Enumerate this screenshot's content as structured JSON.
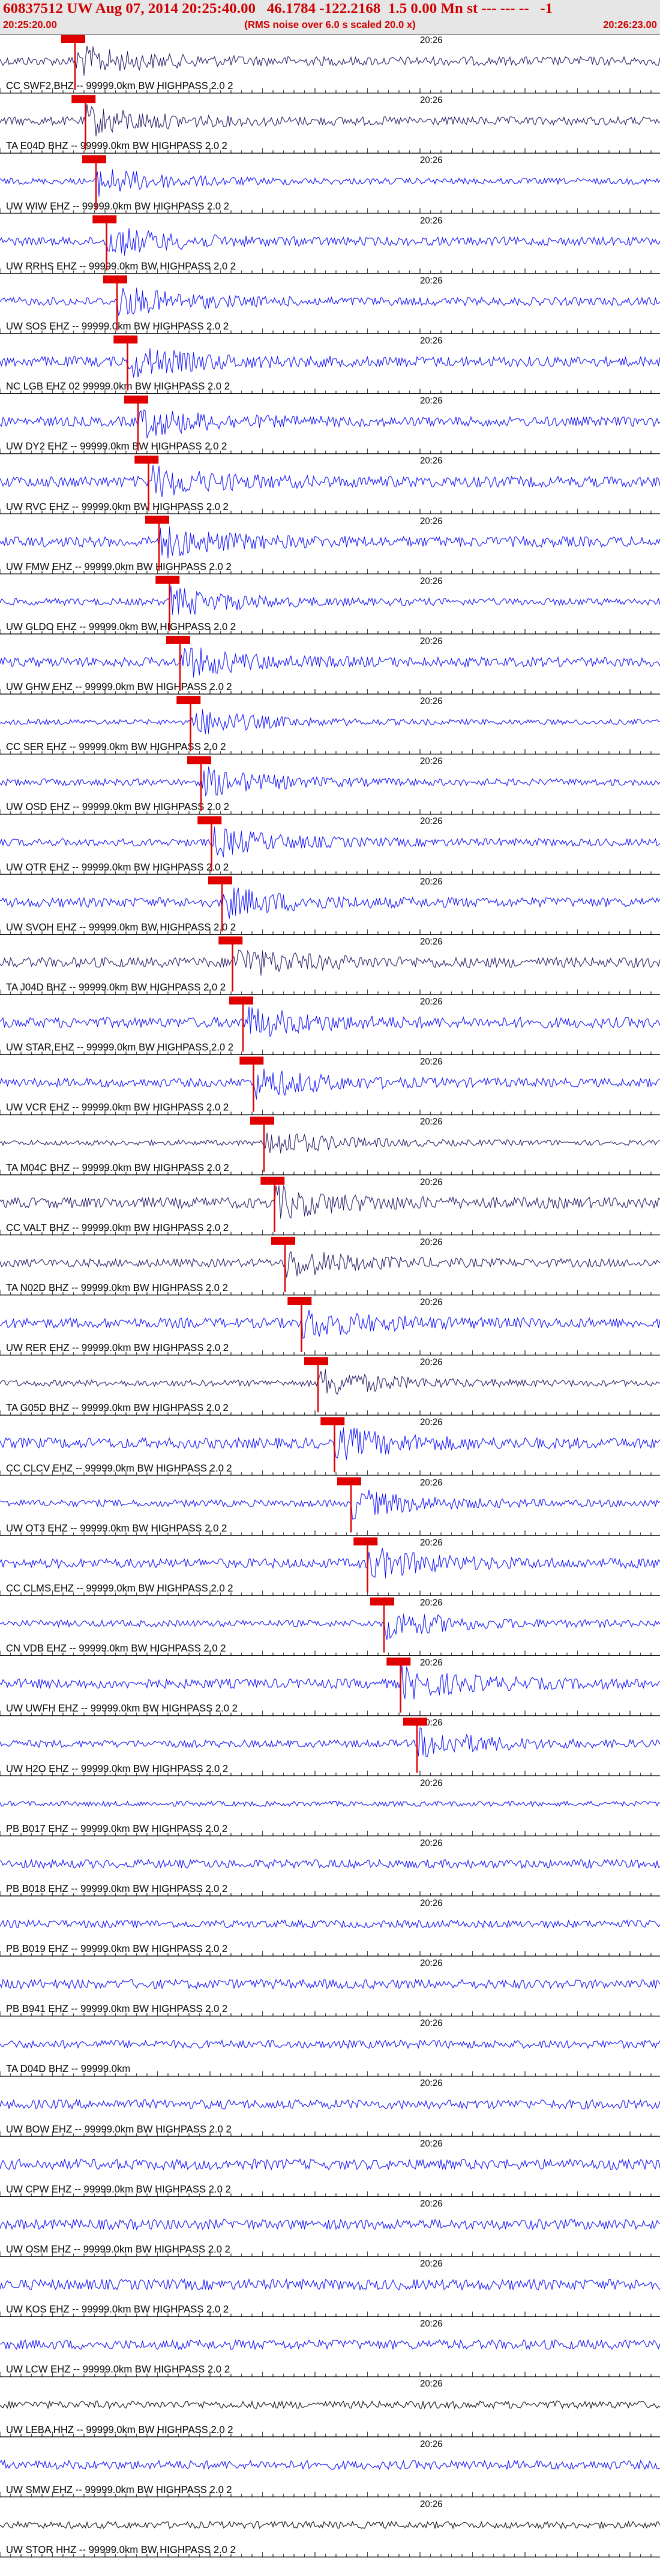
{
  "header": {
    "title": "60837512 UW Aug 07, 2014 20:25:40.00   46.1784 -122.2168  1.5 0.00 Mn st --- --- --   -1",
    "rms_note": "(RMS noise over 6.0 s scaled 20.0 x)",
    "start_time": "20:25:20.00",
    "end_time": "20:26:23.00"
  },
  "colors": {
    "trace_blue": "#0000ff",
    "trace_navy": "#1a0a5e",
    "trace_black": "#000000",
    "pick_red": "#e00000",
    "header_red": "#d00000"
  },
  "chart_data": {
    "type": "seismogram",
    "time_range": [
      "20:25:20.00",
      "20:26:23.00"
    ],
    "minute_mark_label": "20:26",
    "channels": [
      {
        "label": "CC SWF2 BHZ -- 99999.0km BW  HIGHPASS  2.0  2",
        "pick": true,
        "color": "navy"
      },
      {
        "label": "TA E04D BHZ -- 99999.0km BW  HIGHPASS  2.0  2",
        "pick": true,
        "color": "navy"
      },
      {
        "label": "UW WIW EHZ -- 99999.0km BW  HIGHPASS  2.0  2",
        "pick": true,
        "color": "blue"
      },
      {
        "label": "UW RRHS EHZ -- 99999.0km BW  HIGHPASS  2.0  2",
        "pick": true,
        "color": "blue"
      },
      {
        "label": "UW SOS EHZ -- 99999.0km BW  HIGHPASS  2.0  2",
        "pick": true,
        "color": "blue"
      },
      {
        "label": "NC LGB EHZ 02 99999.0km BW  HIGHPASS  2.0  2",
        "pick": true,
        "color": "blue"
      },
      {
        "label": "UW DY2 EHZ -- 99999.0km BW  HIGHPASS  2.0  2",
        "pick": true,
        "color": "blue"
      },
      {
        "label": "UW RVC EHZ -- 99999.0km BW  HIGHPASS  2.0  2",
        "pick": true,
        "color": "blue"
      },
      {
        "label": "UW FMW EHZ -- 99999.0km BW  HIGHPASS  2.0  2",
        "pick": true,
        "color": "blue"
      },
      {
        "label": "UW GLDO EHZ -- 99999.0km BW  HIGHPASS  2.0  2",
        "pick": true,
        "color": "blue"
      },
      {
        "label": "UW GHW EHZ -- 99999.0km BW  HIGHPASS  2.0  2",
        "pick": true,
        "color": "blue"
      },
      {
        "label": "CC SER EHZ -- 99999.0km BW  HIGHPASS  2.0  2",
        "pick": true,
        "color": "blue"
      },
      {
        "label": "UW OSD EHZ -- 99999.0km BW  HIGHPASS  2.0  2",
        "pick": true,
        "color": "blue"
      },
      {
        "label": "UW OTR EHZ -- 99999.0km BW  HIGHPASS  2.0  2",
        "pick": true,
        "color": "blue"
      },
      {
        "label": "UW SVOH EHZ -- 99999.0km BW  HIGHPASS  2.0  2",
        "pick": true,
        "color": "blue"
      },
      {
        "label": "TA J04D BHZ -- 99999.0km BW  HIGHPASS  2.0  2",
        "pick": true,
        "color": "navy"
      },
      {
        "label": "UW STAR EHZ -- 99999.0km BW  HIGHPASS  2.0  2",
        "pick": true,
        "color": "blue"
      },
      {
        "label": "UW VCR EHZ -- 99999.0km BW  HIGHPASS  2.0  2",
        "pick": true,
        "color": "blue"
      },
      {
        "label": "TA M04C BHZ -- 99999.0km BW  HIGHPASS  2.0  2",
        "pick": true,
        "color": "navy"
      },
      {
        "label": "CC VALT BHZ -- 99999.0km BW  HIGHPASS  2.0  2",
        "pick": true,
        "color": "navy"
      },
      {
        "label": "TA N02D BHZ -- 99999.0km BW  HIGHPASS  2.0  2",
        "pick": true,
        "color": "navy"
      },
      {
        "label": "UW RER EHZ -- 99999.0km BW  HIGHPASS  2.0  2",
        "pick": true,
        "color": "blue"
      },
      {
        "label": "TA G05D BHZ -- 99999.0km BW  HIGHPASS  2.0  2",
        "pick": true,
        "color": "navy"
      },
      {
        "label": "CC CLCV EHZ -- 99999.0km BW  HIGHPASS  2.0  2",
        "pick": true,
        "color": "blue"
      },
      {
        "label": "UW OT3 EHZ -- 99999.0km BW  HIGHPASS  2.0  2",
        "pick": true,
        "color": "blue"
      },
      {
        "label": "CC CLMS EHZ -- 99999.0km BW  HIGHPASS  2.0  2",
        "pick": true,
        "color": "blue"
      },
      {
        "label": "CN VDB EHZ -- 99999.0km BW  HIGHPASS  2.0  2",
        "pick": true,
        "color": "blue"
      },
      {
        "label": "UW UWFH EHZ -- 99999.0km BW  HIGHPASS  2.0  2",
        "pick": true,
        "color": "blue"
      },
      {
        "label": "UW H2O EHZ -- 99999.0km BW  HIGHPASS  2.0  2",
        "pick": true,
        "color": "blue"
      },
      {
        "label": "PB B017 EHZ -- 99999.0km BW  HIGHPASS  2.0  2",
        "pick": false,
        "color": "blue"
      },
      {
        "label": "PB B018 EHZ -- 99999.0km BW  HIGHPASS  2.0  2",
        "pick": false,
        "color": "blue"
      },
      {
        "label": "PB B019 EHZ -- 99999.0km BW  HIGHPASS  2.0  2",
        "pick": false,
        "color": "blue"
      },
      {
        "label": "PB B941 EHZ -- 99999.0km BW  HIGHPASS  2.0  2",
        "pick": false,
        "color": "blue"
      },
      {
        "label": "TA D04D BHZ -- 99999.0km",
        "pick": false,
        "color": "blue"
      },
      {
        "label": "UW BOW EHZ -- 99999.0km BW  HIGHPASS  2.0  2",
        "pick": false,
        "color": "blue"
      },
      {
        "label": "UW CPW EHZ -- 99999.0km BW  HIGHPASS  2.0  2",
        "pick": false,
        "color": "blue"
      },
      {
        "label": "UW OSM EHZ -- 99999.0km BW  HIGHPASS  2.0  2",
        "pick": false,
        "color": "blue"
      },
      {
        "label": "UW KOS EHZ -- 99999.0km BW  HIGHPASS  2.0  2",
        "pick": false,
        "color": "blue"
      },
      {
        "label": "UW LCW EHZ -- 99999.0km BW  HIGHPASS  2.0  2",
        "pick": false,
        "color": "blue"
      },
      {
        "label": "UW LEBA HHZ -- 99999.0km BW  HIGHPASS  2.0  2",
        "pick": false,
        "color": "black"
      },
      {
        "label": "UW SMW EHZ -- 99999.0km BW  HIGHPASS  2.0  2",
        "pick": false,
        "color": "blue"
      },
      {
        "label": "UW STOR HHZ -- 99999.0km BW  HIGHPASS  2.0  2",
        "pick": false,
        "color": "black"
      }
    ]
  }
}
